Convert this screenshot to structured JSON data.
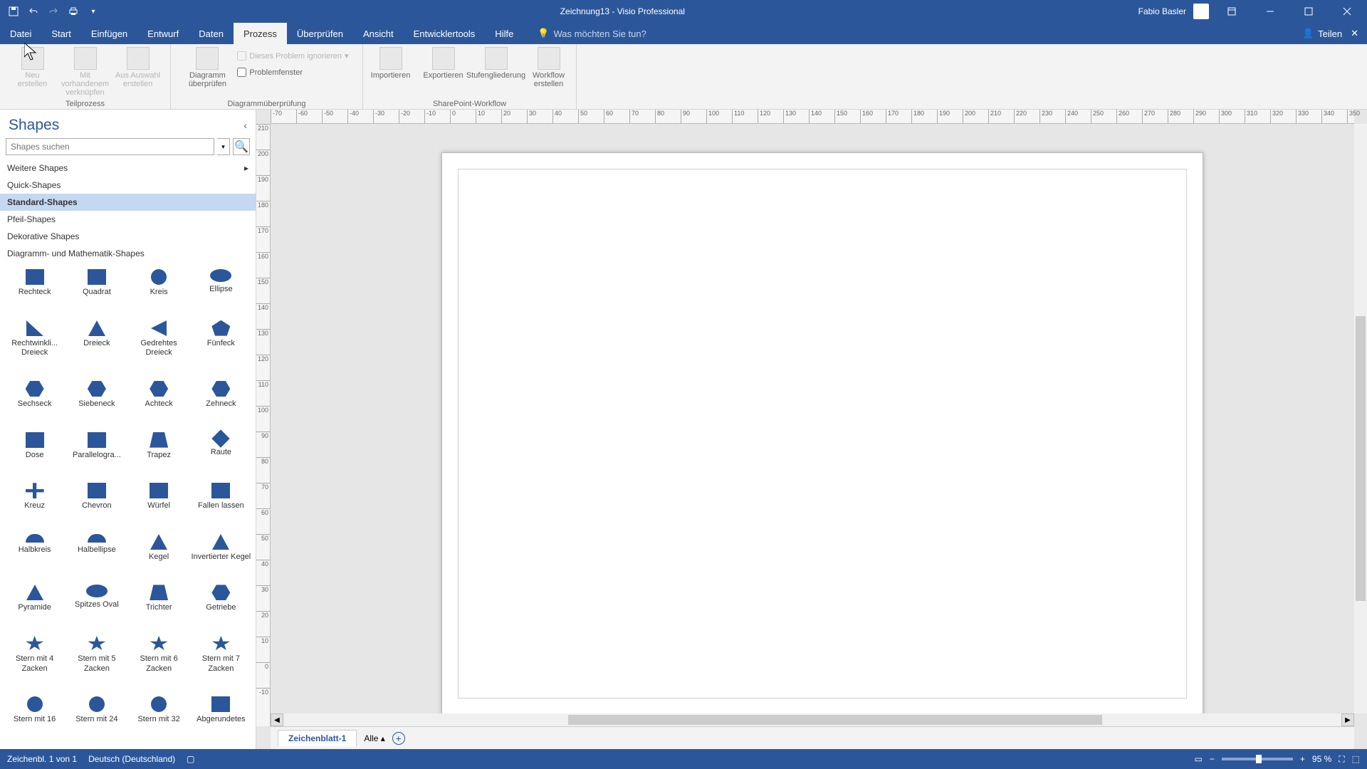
{
  "title": "Zeichnung13  -  Visio Professional",
  "user": "Fabio Basler",
  "tabs": [
    "Datei",
    "Start",
    "Einfügen",
    "Entwurf",
    "Daten",
    "Prozess",
    "Überprüfen",
    "Ansicht",
    "Entwicklertools",
    "Hilfe"
  ],
  "active_tab": 5,
  "tellme": "Was möchten Sie tun?",
  "share": "Teilen",
  "ribbon": {
    "g1": {
      "label": "Teilprozess",
      "btns": [
        "Neu erstellen",
        "Mit vorhandenem verknüpfen",
        "Aus Auswahl erstellen"
      ]
    },
    "g2": {
      "label": "Diagrammüberprüfung",
      "btn": "Diagramm überprüfen",
      "chk1": "Dieses Problem ignorieren",
      "chk2": "Problemfenster"
    },
    "g3": {
      "label": "SharePoint-Workflow",
      "btns": [
        "Importieren",
        "Exportieren",
        "Stufengliederung",
        "Workflow erstellen"
      ]
    }
  },
  "shapes": {
    "title": "Shapes",
    "search_ph": "Shapes suchen",
    "cats": [
      "Weitere Shapes",
      "Quick-Shapes",
      "Standard-Shapes",
      "Pfeil-Shapes",
      "Dekorative Shapes",
      "Diagramm- und Mathematik-Shapes"
    ],
    "items": [
      "Rechteck",
      "Quadrat",
      "Kreis",
      "Ellipse",
      "Rechtwinkli... Dreieck",
      "Dreieck",
      "Gedrehtes Dreieck",
      "Fünfeck",
      "Sechseck",
      "Siebeneck",
      "Achteck",
      "Zehneck",
      "Dose",
      "Parallelogra...",
      "Trapez",
      "Raute",
      "Kreuz",
      "Chevron",
      "Würfel",
      "Fallen lassen",
      "Halbkreis",
      "Halbellipse",
      "Kegel",
      "Invertierter Kegel",
      "Pyramide",
      "Spitzes Oval",
      "Trichter",
      "Getriebe",
      "Stern mit 4 Zacken",
      "Stern mit 5 Zacken",
      "Stern mit 6 Zacken",
      "Stern mit 7 Zacken",
      "Stern mit 16",
      "Stern mit 24",
      "Stern mit 32",
      "Abgerundetes"
    ]
  },
  "hruler_ticks": [
    "-70",
    "-60",
    "-50",
    "-40",
    "-30",
    "-20",
    "-10",
    "0",
    "10",
    "20",
    "30",
    "40",
    "50",
    "60",
    "70",
    "80",
    "90",
    "100",
    "110",
    "120",
    "130",
    "140",
    "150",
    "160",
    "170",
    "180",
    "190",
    "200",
    "210",
    "220",
    "230",
    "240",
    "250",
    "260",
    "270",
    "280",
    "290",
    "300",
    "310",
    "320",
    "330",
    "340",
    "350"
  ],
  "vruler_ticks": [
    "210",
    "200",
    "190",
    "180",
    "170",
    "160",
    "150",
    "140",
    "130",
    "120",
    "110",
    "100",
    "90",
    "80",
    "70",
    "60",
    "50",
    "40",
    "30",
    "20",
    "10",
    "0",
    "-10"
  ],
  "sheet": "Zeichenblatt-1",
  "all": "Alle",
  "status_left": "Zeichenbl. 1 von 1",
  "status_lang": "Deutsch (Deutschland)",
  "zoom": "95 %"
}
